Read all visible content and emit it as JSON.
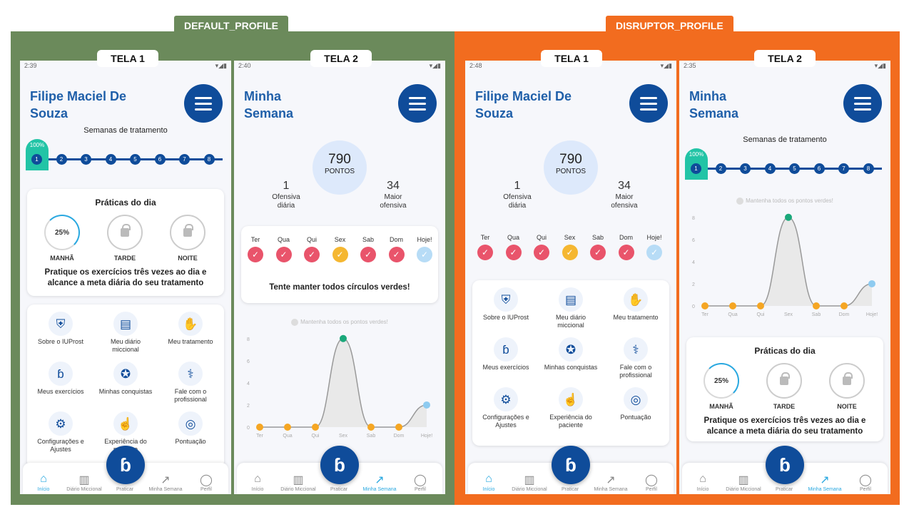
{
  "profiles": {
    "default": {
      "label": "DEFAULT_PROFILE",
      "color": "#6b8a5b"
    },
    "disruptor": {
      "label": "DISRUPTOR_PROFILE",
      "color": "#f26c1f"
    }
  },
  "screens": {
    "d1": {
      "tag": "TELA 1",
      "time": "2:39",
      "title_l1": "Filipe Maciel De",
      "title_l2": "Souza"
    },
    "d2": {
      "tag": "TELA 2",
      "time": "2:40",
      "title_l1": "Minha",
      "title_l2": "Semana"
    },
    "r1": {
      "tag": "TELA 1",
      "time": "2:48",
      "title_l1": "Filipe Maciel De",
      "title_l2": "Souza"
    },
    "r2": {
      "tag": "TELA 2",
      "time": "2:35",
      "title_l1": "Minha",
      "title_l2": "Semana"
    }
  },
  "status_icons": "▾◢▮",
  "weeks": {
    "title": "Semanas de tratamento",
    "current_progress": "100%",
    "numbers": [
      "1",
      "2",
      "3",
      "4",
      "5",
      "6",
      "7",
      "8"
    ]
  },
  "practices": {
    "title": "Práticas do dia",
    "morning_percent": "25%",
    "labels": [
      "MANHÃ",
      "TARDE",
      "NOITE"
    ],
    "note_l1": "Pratique os exercícios três vezes ao dia e",
    "note_l2": "alcance a meta diária do seu tratamento"
  },
  "grid": [
    {
      "icon": "user-shield-icon",
      "glyph": "⛨",
      "l1": "Sobre o IUProst",
      "l2": ""
    },
    {
      "icon": "book-icon",
      "glyph": "▤",
      "l1": "Meu diário",
      "l2": "miccional"
    },
    {
      "icon": "hand-drop-icon",
      "glyph": "✋",
      "l1": "Meu tratamento",
      "l2": ""
    },
    {
      "icon": "arm-icon",
      "glyph": "ɓ",
      "l1": "Meus exercícios",
      "l2": ""
    },
    {
      "icon": "medal-icon",
      "glyph": "✪",
      "l1": "Minhas conquistas",
      "l2": ""
    },
    {
      "icon": "doctor-icon",
      "glyph": "⚕",
      "l1": "Fale com o",
      "l2": "profissional"
    },
    {
      "icon": "gears-icon",
      "glyph": "⚙",
      "l1": "Configurações e",
      "l2": "Ajustes"
    },
    {
      "icon": "pointer-icon",
      "glyph": "☝",
      "l1": "Experiência do",
      "l2": "paciente"
    },
    {
      "icon": "coins-icon",
      "glyph": "◎",
      "l1": "Pontuação",
      "l2": ""
    }
  ],
  "tabs": [
    "Início",
    "Diário Miccional",
    "Praticar",
    "Minha Semana",
    "Perfil"
  ],
  "week": {
    "points": "790",
    "points_label": "PONTOS",
    "streak_value": "1",
    "streak_l1": "Ofensiva",
    "streak_l2": "diária",
    "max_value": "34",
    "max_l1": "Maior",
    "max_l2": "ofensiva",
    "days": [
      "Ter",
      "Qua",
      "Qui",
      "Sex",
      "Sab",
      "Dom",
      "Hoje!"
    ],
    "day_status": [
      "red",
      "red",
      "red",
      "yellow",
      "red",
      "red",
      "blue"
    ],
    "tip": "Tente manter todos círculos verdes!",
    "legend": "Mantenha todos os pontos verdes!"
  },
  "chart_data": {
    "type": "line",
    "categories": [
      "Ter",
      "Qua",
      "Qui",
      "Sex",
      "Sab",
      "Dom",
      "Hoje!"
    ],
    "values": [
      0,
      0,
      0,
      8,
      0,
      0,
      2
    ],
    "yticks": [
      0,
      2,
      4,
      6,
      8
    ],
    "ylim": [
      0,
      8.5
    ],
    "point_colors": [
      "#f5a623",
      "#f5a623",
      "#f5a623",
      "#1aa87a",
      "#f5a623",
      "#f5a623",
      "#8ecbf0"
    ]
  }
}
